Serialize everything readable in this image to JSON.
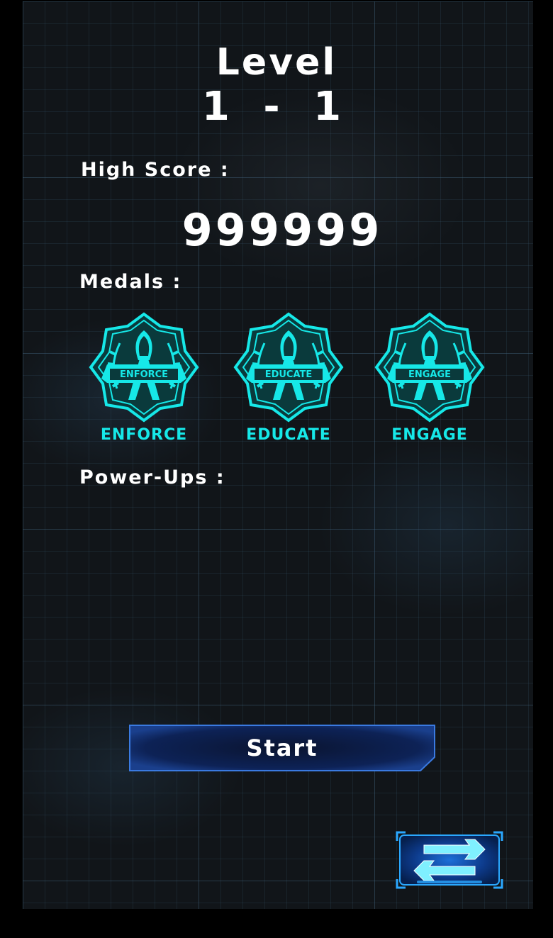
{
  "header": {
    "title": "Level",
    "level_number": "1 - 1"
  },
  "high_score": {
    "label": "High Score :",
    "value": "999999"
  },
  "medals": {
    "label": "Medals :",
    "items": [
      {
        "name": "ENFORCE",
        "ribbon": "ENFORCE",
        "icon": "medal-badge-icon"
      },
      {
        "name": "EDUCATE",
        "ribbon": "EDUCATE",
        "icon": "medal-badge-icon"
      },
      {
        "name": "ENGAGE",
        "ribbon": "ENGAGE",
        "icon": "medal-badge-icon"
      }
    ]
  },
  "power_ups": {
    "label": "Power-Ups :"
  },
  "actions": {
    "start_label": "Start",
    "swap_icon": "swap-arrows-icon"
  },
  "colors": {
    "medal": "#16e8e8",
    "button_border": "#3a7ae0",
    "button_fill": "#0c1d4a",
    "swap_glow": "#2aa8ff"
  }
}
